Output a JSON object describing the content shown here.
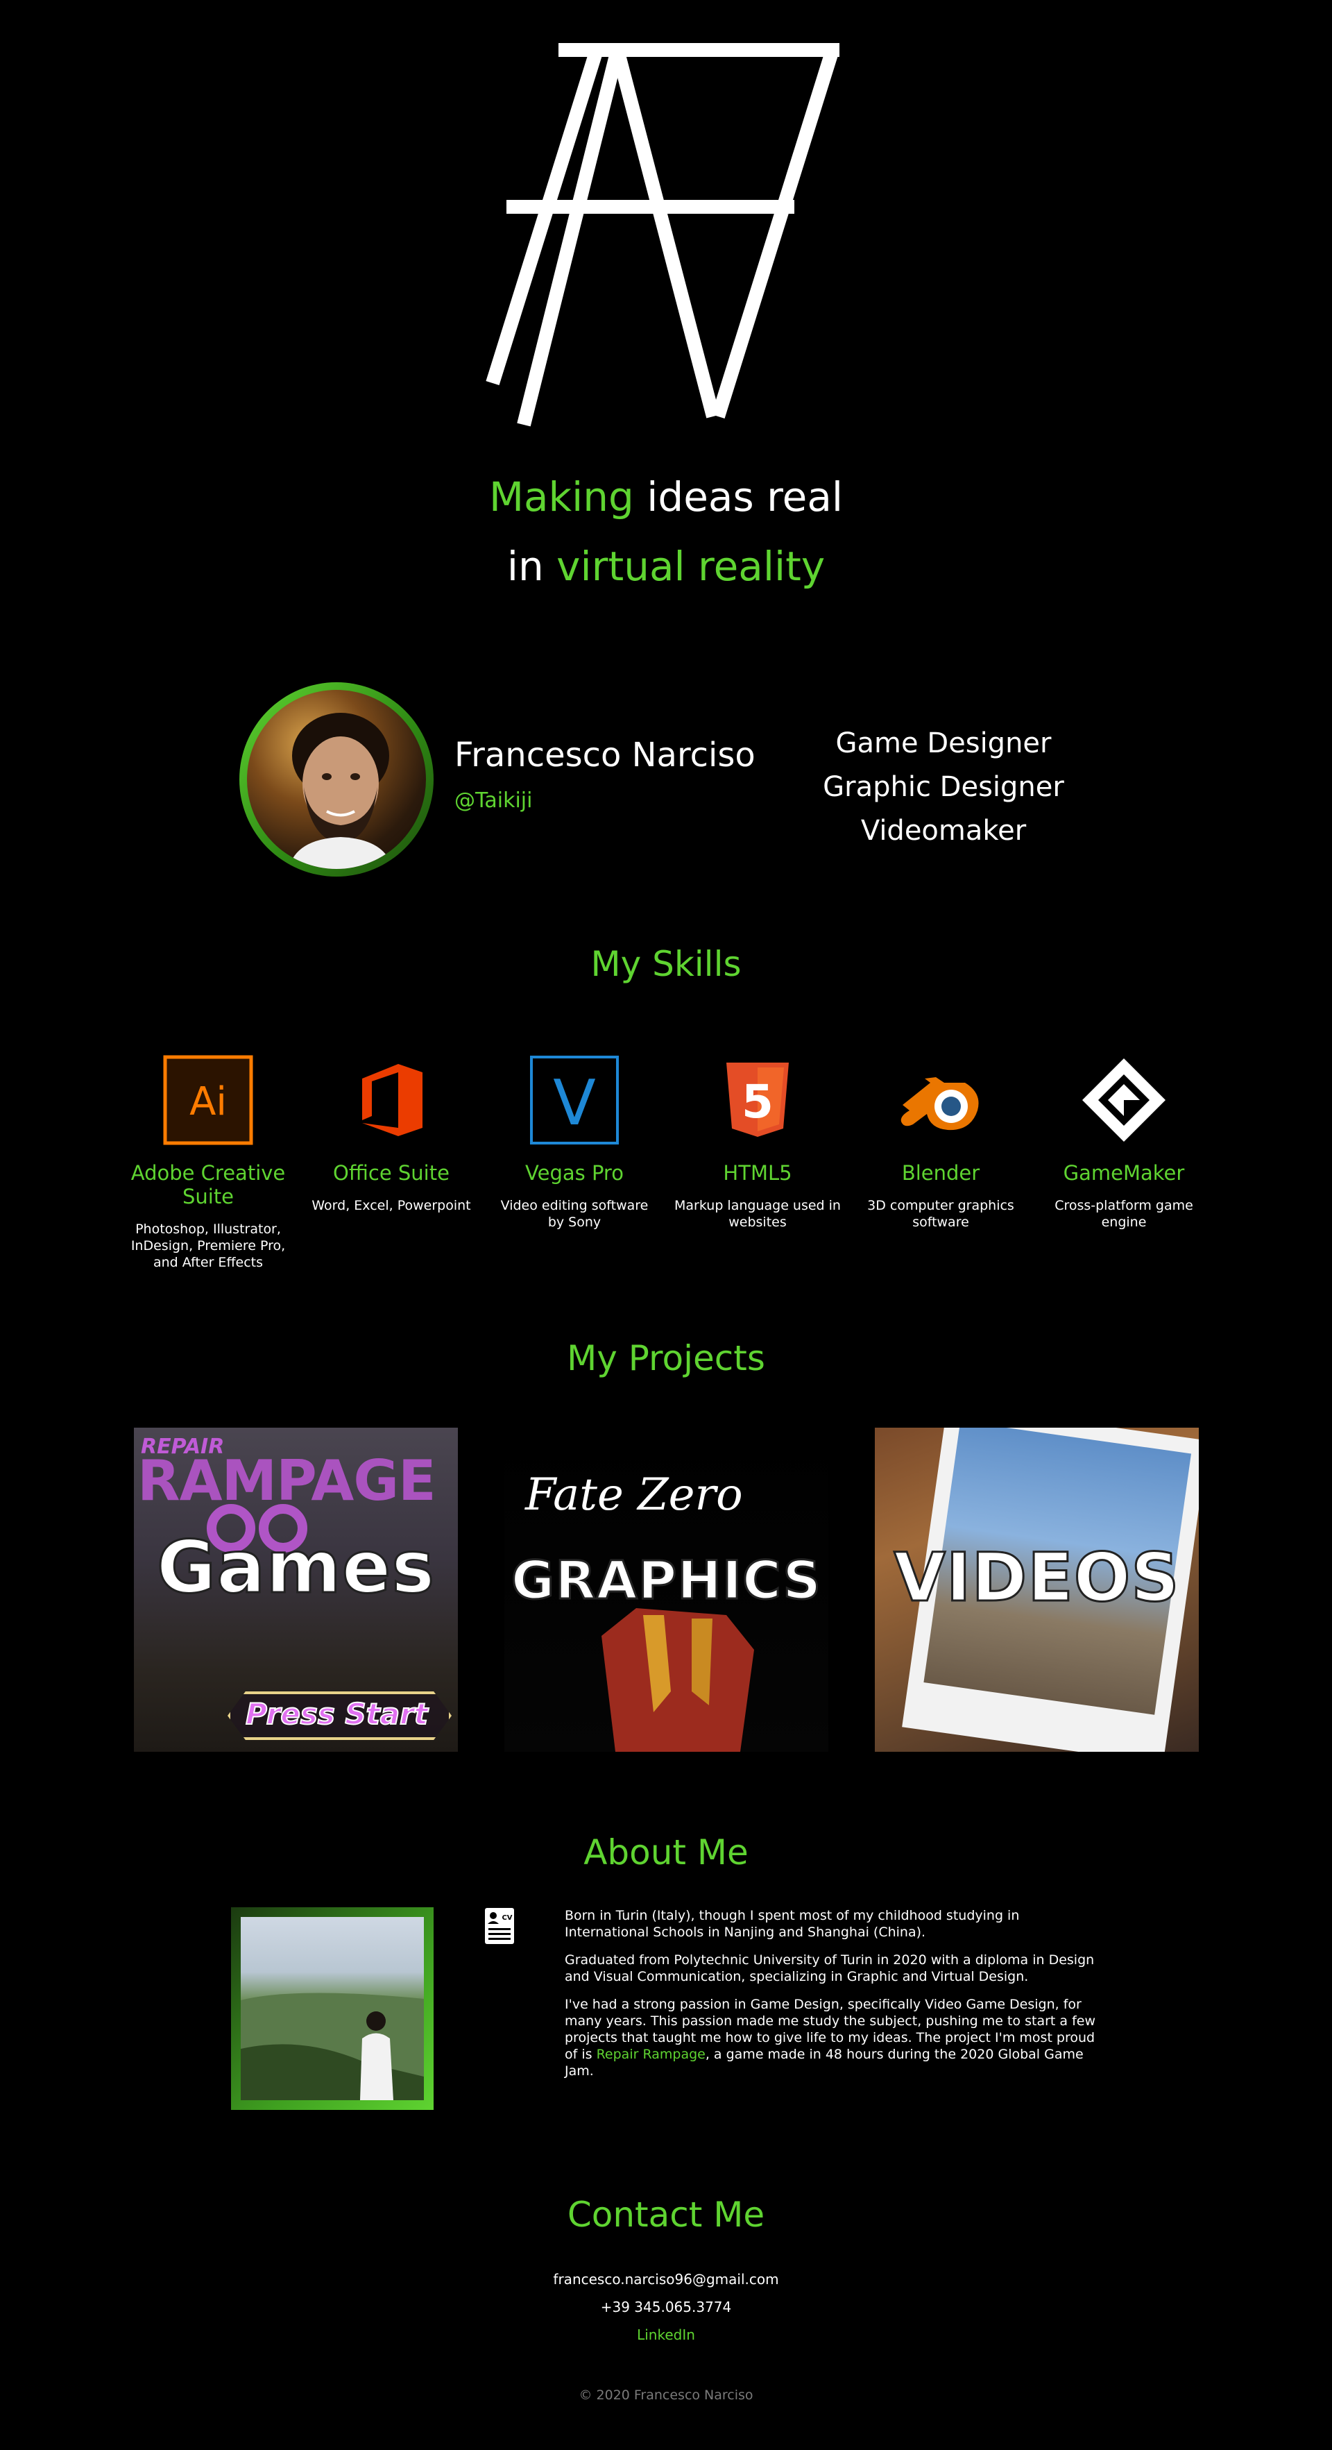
{
  "logo": {
    "icon": "fn-monogram-logo",
    "color": "#ffffff"
  },
  "tagline": {
    "line1_accent": "Making",
    "line1_rest": "ideas real",
    "line2_lead": "in",
    "line2_accent": "virtual reality"
  },
  "profile": {
    "name": "Francesco Narciso",
    "handle": "@Taikiji",
    "roles": [
      "Game Designer",
      "Graphic Designer",
      "Videomaker"
    ]
  },
  "skills": {
    "title": "My Skills",
    "items": [
      {
        "name": "Adobe Creative Suite",
        "desc": "Photoshop, Illustrator, InDesign, Premiere Pro, and After Effects",
        "icon": "adobe-illustrator-icon",
        "glyph": "Ai"
      },
      {
        "name": "Office Suite",
        "desc": "Word, Excel, Powerpoint",
        "icon": "office-icon"
      },
      {
        "name": "Vegas Pro",
        "desc": "Video editing software by Sony",
        "icon": "vegas-pro-icon",
        "glyph": "V"
      },
      {
        "name": "HTML5",
        "desc": "Markup language used in websites",
        "icon": "html5-icon",
        "glyph": "5"
      },
      {
        "name": "Blender",
        "desc": "3D computer graphics software",
        "icon": "blender-icon"
      },
      {
        "name": "GameMaker",
        "desc": "Cross-platform game engine",
        "icon": "gamemaker-icon"
      }
    ]
  },
  "projects": {
    "title": "My Projects",
    "items": [
      {
        "label": "Games",
        "art_title": "RAMPAGE",
        "art_kicker": "REPAIR",
        "art_button": "Press Start"
      },
      {
        "label": "GRAPHICS",
        "art_title": "Fate Zero"
      },
      {
        "label": "VIDEOS"
      }
    ]
  },
  "about": {
    "title": "About Me",
    "p1": "Born in Turin (Italy), though I spent most of my childhood studying in International Schools in Nanjing and Shanghai (China).",
    "p2": "Graduated from Polytechnic University of Turin in 2020 with a diploma in Design and Visual Communication, specializing in Graphic and Virtual Design.",
    "p3_before": "I've had a strong passion in Game Design, specifically Video Game Design, for many years. This passion made me study the subject, pushing me to start a few projects that taught me how to give life to my ideas. The project I'm most proud of is ",
    "p3_link": "Repair Rampage",
    "p3_after": ", a game made in 48 hours during the 2020 Global Game Jam.",
    "cv_icon_label": "CV"
  },
  "contact": {
    "title": "Contact Me",
    "email": "francesco.narciso96@gmail.com",
    "phone": "+39 345.065.3774",
    "linkedin": "LinkedIn"
  },
  "footer": "© 2020 Francesco Narciso",
  "colors": {
    "accent": "#5fd431",
    "background": "#000000",
    "text": "#ffffff"
  }
}
